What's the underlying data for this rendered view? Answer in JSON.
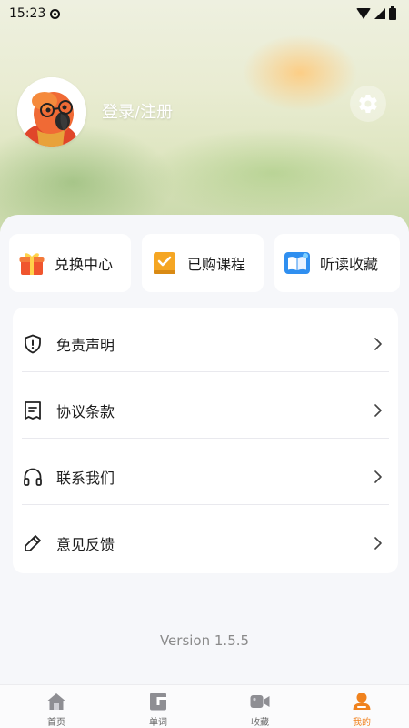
{
  "status_bar": {
    "time": "15:23",
    "icons": [
      "wifi-icon",
      "signal-icon",
      "battery-icon"
    ]
  },
  "profile": {
    "login_label": "登录/注册",
    "avatar": "parrot-avatar",
    "settings_icon": "gear-icon"
  },
  "quick_actions": [
    {
      "label": "兑换中心",
      "icon": "gift-icon"
    },
    {
      "label": "已购课程",
      "icon": "course-book-icon"
    },
    {
      "label": "听读收藏",
      "icon": "open-book-icon"
    }
  ],
  "menu": [
    {
      "label": "免责声明",
      "icon": "shield-icon"
    },
    {
      "label": "协议条款",
      "icon": "document-icon"
    },
    {
      "label": "联系我们",
      "icon": "headphones-icon"
    },
    {
      "label": "意见反馈",
      "icon": "pencil-icon"
    }
  ],
  "version": "Version 1.5.5",
  "tabs": [
    {
      "label": "首页",
      "icon": "home-icon",
      "active": false
    },
    {
      "label": "单词",
      "icon": "flashcard-icon",
      "active": false
    },
    {
      "label": "收藏",
      "icon": "video-icon",
      "active": false
    },
    {
      "label": "我的",
      "icon": "user-icon",
      "active": true
    }
  ],
  "colors": {
    "accent": "#f0821e",
    "gift": "#f0552e",
    "course_book": "#f5a623",
    "open_book": "#2f8ff0"
  }
}
